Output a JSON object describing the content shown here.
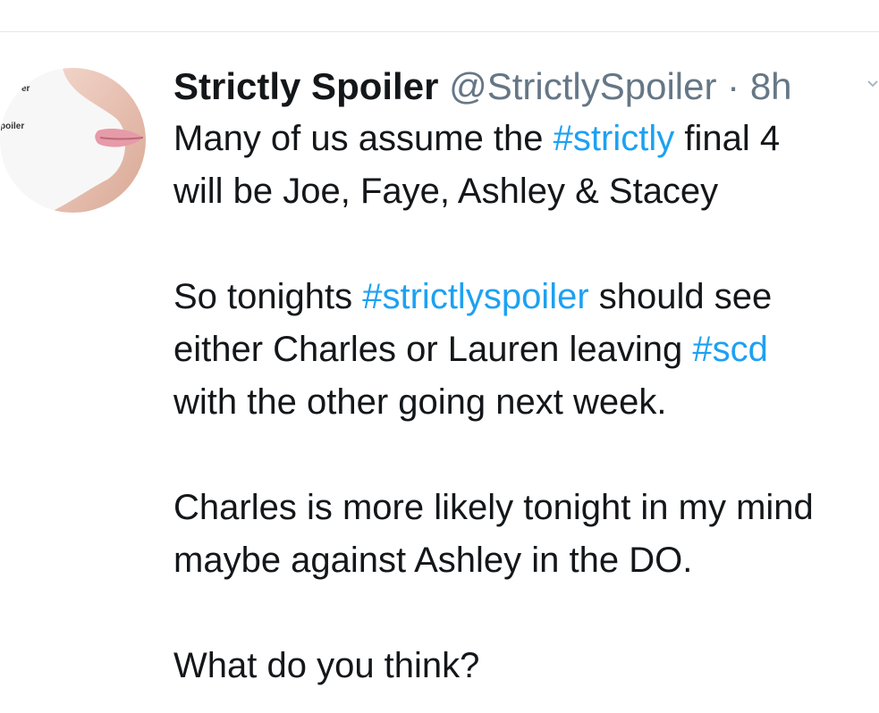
{
  "tweet": {
    "display_name": "Strictly Spoiler",
    "handle": "@StrictlySpoiler",
    "separator": "·",
    "timestamp": "8h",
    "avatar": {
      "label_top": "er",
      "label_bottom": "poiler"
    },
    "body": {
      "line1_pre": "Many of us assume the ",
      "line1_tag": "#strictly",
      "line1_post": " final 4",
      "line2": "will be Joe, Faye, Ashley & Stacey",
      "line4_pre": "So tonights ",
      "line4_tag": "#strictlyspoiler",
      "line4_post": " should see",
      "line5_pre": "either Charles or Lauren leaving ",
      "line5_tag": "#scd",
      "line6": "with the other going next week.",
      "line8": "Charles is more likely tonight in my mind",
      "line9": "maybe against Ashley in the DO.",
      "line11": "What do you think?"
    }
  },
  "colors": {
    "text": "#14171a",
    "secondary": "#657786",
    "hashtag": "#1da1f2",
    "divider": "#e1e8ed"
  },
  "icons": {
    "more": "chevron-down-icon"
  }
}
